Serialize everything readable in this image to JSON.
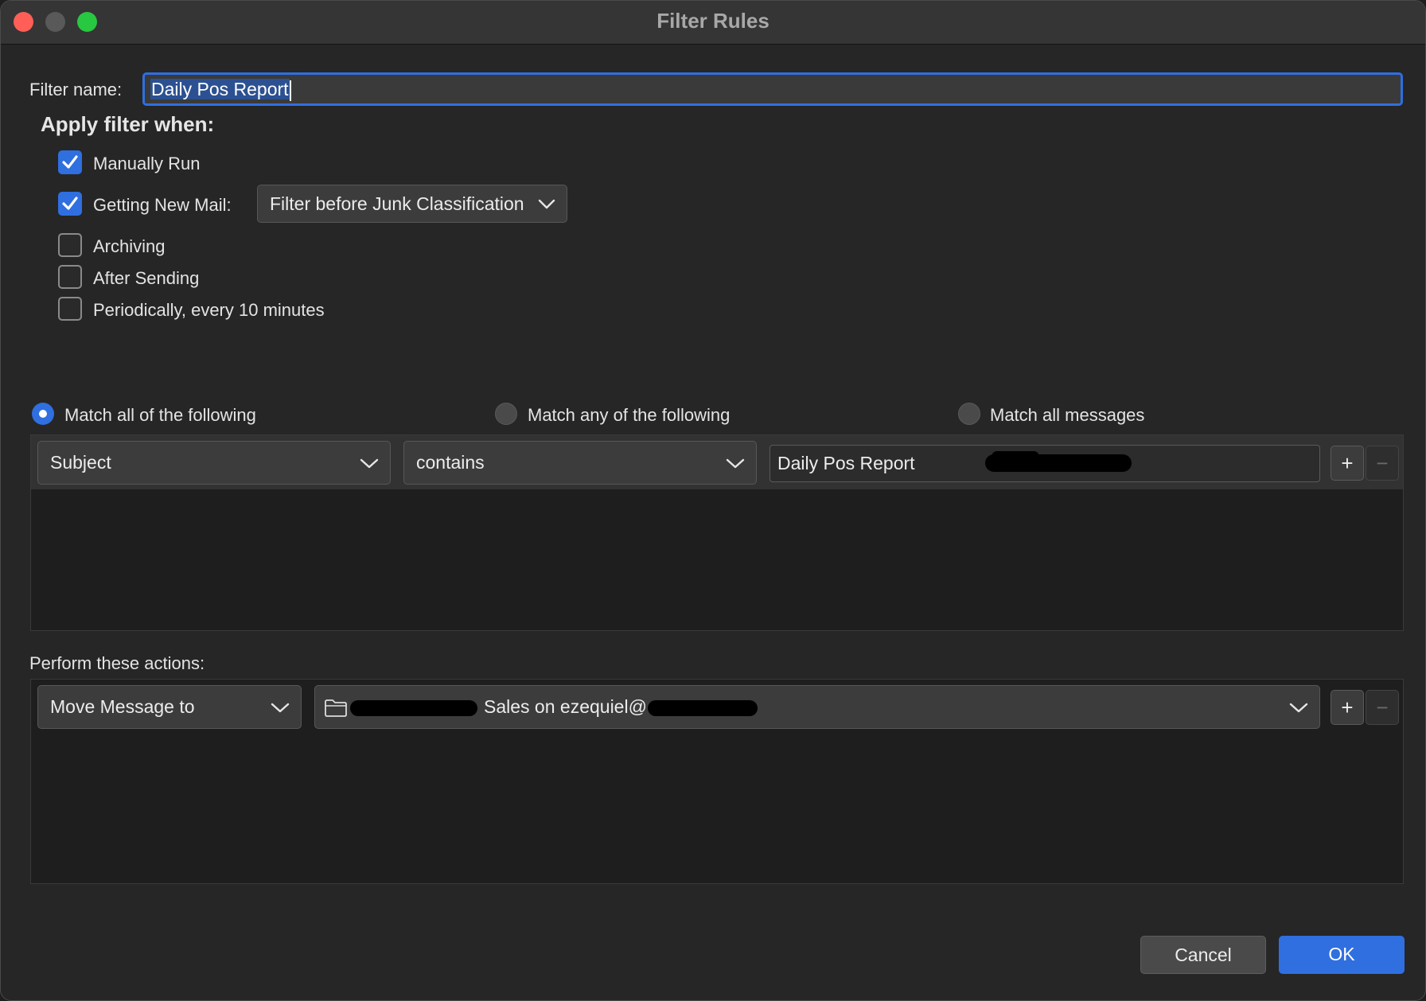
{
  "window": {
    "title": "Filter Rules"
  },
  "filter_name": {
    "label": "Filter name:",
    "value": "Daily Pos Report"
  },
  "apply": {
    "heading": "Apply filter when:",
    "manually_run": {
      "label": "Manually Run",
      "checked": true
    },
    "getting_new_mail": {
      "label": "Getting New Mail:",
      "checked": true,
      "option": "Filter before Junk Classification"
    },
    "archiving": {
      "label": "Archiving",
      "checked": false
    },
    "after_sending": {
      "label": "After Sending",
      "checked": false
    },
    "periodically": {
      "label": "Periodically, every 10 minutes",
      "checked": false
    }
  },
  "match": {
    "all_following": "Match all of the following",
    "any_following": "Match any of the following",
    "all_messages": "Match all messages",
    "selected": "all_following"
  },
  "rule": {
    "field": "Subject",
    "operator": "contains",
    "value": "Daily Pos Report",
    "add": "+",
    "remove": "−"
  },
  "actions": {
    "label": "Perform these actions:",
    "action": "Move Message to",
    "folder_visible": "Sales on ezequiel@",
    "add": "+",
    "remove": "−"
  },
  "buttons": {
    "cancel": "Cancel",
    "ok": "OK"
  },
  "colors": {
    "accent": "#2f6fe0",
    "background": "#262626"
  }
}
